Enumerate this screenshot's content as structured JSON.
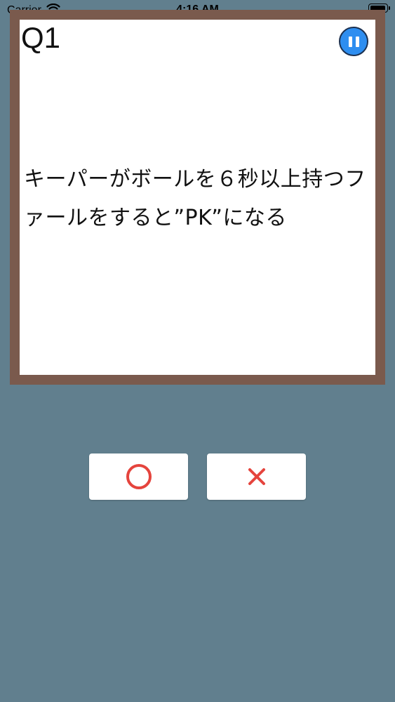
{
  "status_bar": {
    "carrier": "Carrier",
    "time": "4:16 AM",
    "icons": [
      "wifi-icon",
      "battery-icon"
    ]
  },
  "quiz": {
    "question_number": "Q1",
    "question_text": "キーパーがボールを６秒以上持つファールをすると”PK”になる",
    "pause_icon": "pause-icon"
  },
  "answers": {
    "true_icon": "circle-icon",
    "false_icon": "cross-icon"
  },
  "colors": {
    "background": "#617f8e",
    "board_frame": "#7a5a4d",
    "pause_button": "#2e8ef0",
    "answer_mark": "#e5443d"
  }
}
